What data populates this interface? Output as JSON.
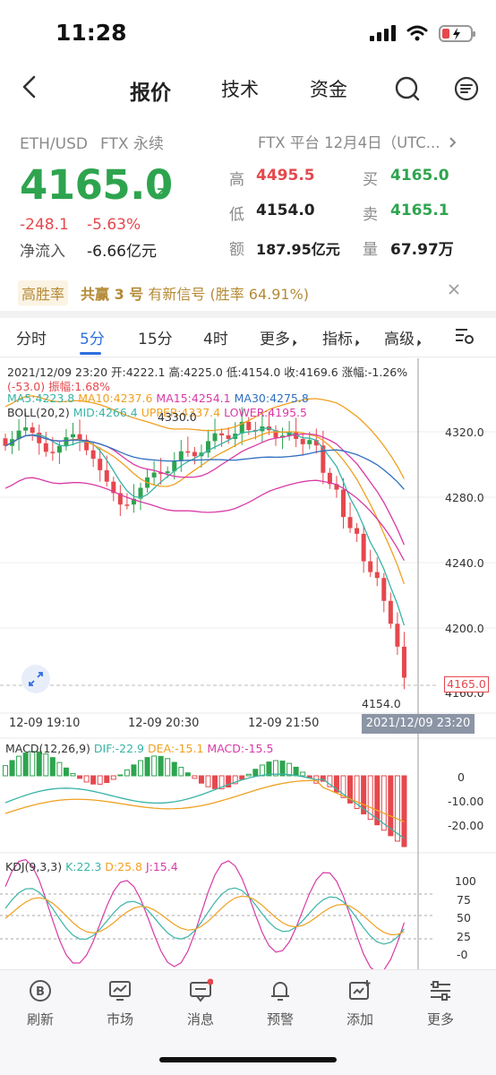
{
  "status": {
    "time": "11:28"
  },
  "nav": {
    "tabs": [
      "报价",
      "技术",
      "资金"
    ],
    "active": 0
  },
  "quote": {
    "pair": "ETH/USD",
    "contract": "FTX 永续",
    "venue": "FTX 平台 12月4日（UTC...",
    "price": "4165.0",
    "change": "-248.1",
    "change_pct": "-5.63%",
    "inflow_label": "净流入",
    "inflow_value": "-6.66亿元",
    "stats": [
      {
        "label": "高",
        "value": "4495.5",
        "color": "#e5484d"
      },
      {
        "label": "买",
        "value": "4165.0",
        "color": "#2ea44f"
      },
      {
        "label": "低",
        "value": "4154.0",
        "color": "#222222"
      },
      {
        "label": "卖",
        "value": "4165.1",
        "color": "#2ea44f"
      },
      {
        "label": "额",
        "value": "187.95亿元",
        "color": "#222222"
      },
      {
        "label": "量",
        "value": "67.97万",
        "color": "#222222"
      }
    ]
  },
  "banner": {
    "tag": "高胜率",
    "name": "共赢 3 号",
    "text": "有新信号 (胜率 64.91%)"
  },
  "intervals": [
    "分时",
    "5分",
    "15分",
    "4时",
    "更多",
    "指标",
    "高级"
  ],
  "active_interval": 1,
  "kline": {
    "info1": "2021/12/09 23:20 开:4222.1 高:4225.0 低:4154.0 收:4169.6 涨幅:-1.26%",
    "info2": "(-53.0) 振幅:1.68%",
    "ma": [
      {
        "text": "MA5:4223.8",
        "color": "#39b4a6"
      },
      {
        "text": "MA10:4237.6",
        "color": "#f0a020"
      },
      {
        "text": "MA15:4254.1",
        "color": "#d93aa6"
      },
      {
        "text": "MA30:4275.8",
        "color": "#2f6fc0"
      }
    ],
    "boll": [
      {
        "text": "BOLL(20,2)",
        "color": "#333333"
      },
      {
        "text": "MID:4266.4",
        "color": "#39b4a6"
      },
      {
        "text": "UPPER:4337.4",
        "color": "#f0a020"
      },
      {
        "text": "LOWER:4195.5",
        "color": "#d93aa6"
      }
    ],
    "high_mark": "4330.0",
    "low_mark": "4154.0",
    "y_labels": [
      "4320.0",
      "4280.0",
      "4240.0",
      "4200.0",
      "4160.0"
    ],
    "current_price": "4165.0",
    "time_labels": [
      "12-09 19:10",
      "12-09 20:30",
      "12-09 21:50"
    ],
    "cursor_time": "2021/12/09 23:20"
  },
  "macd": {
    "legend": [
      {
        "text": "MACD(12,26,9)",
        "color": "#333333"
      },
      {
        "text": "DIF:-22.9",
        "color": "#39b4a6"
      },
      {
        "text": "DEA:-15.1",
        "color": "#f0a020"
      },
      {
        "text": "MACD:-15.5",
        "color": "#d93aa6"
      }
    ],
    "y_labels": [
      "0",
      "-10.00",
      "-20.00"
    ]
  },
  "kdj": {
    "legend": [
      {
        "text": "KDJ(9,3,3)",
        "color": "#333333"
      },
      {
        "text": "K:22.3",
        "color": "#39b4a6"
      },
      {
        "text": "D:25.8",
        "color": "#f0a020"
      },
      {
        "text": "J:15.4",
        "color": "#d93aa6"
      }
    ],
    "y_labels": [
      "100",
      "75",
      "50",
      "25",
      "-0"
    ]
  },
  "bottom_nav": [
    {
      "label": "刷新",
      "icon": "refresh-b-icon"
    },
    {
      "label": "市场",
      "icon": "market-icon"
    },
    {
      "label": "消息",
      "icon": "message-icon"
    },
    {
      "label": "预警",
      "icon": "bell-icon"
    },
    {
      "label": "添加",
      "icon": "add-icon"
    },
    {
      "label": "更多",
      "icon": "more-icon"
    }
  ],
  "colors": {
    "up": "#2ea44f",
    "down": "#e5484d",
    "accent": "#2f6fe0"
  }
}
